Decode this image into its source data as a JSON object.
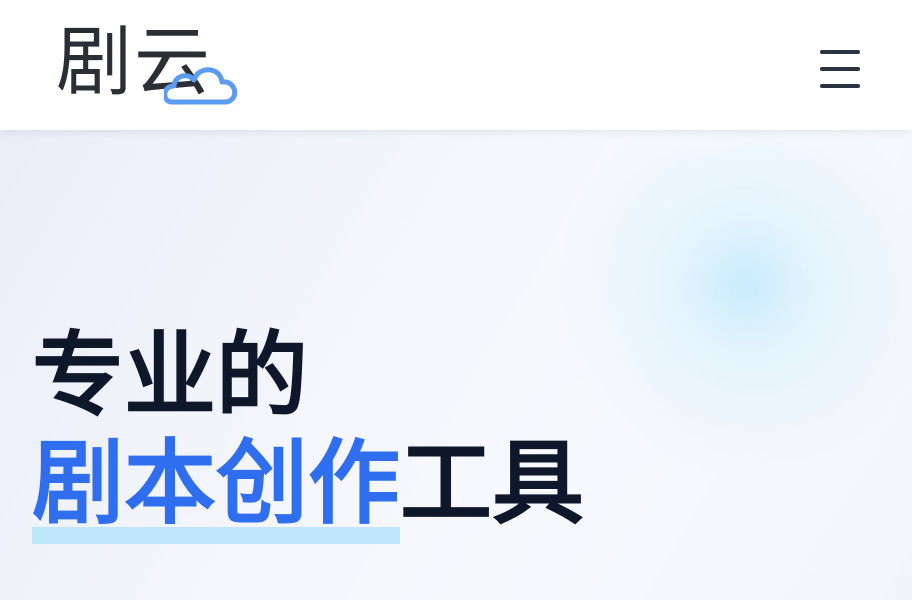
{
  "brand": {
    "logo_text": "剧云",
    "accent_color": "#2f6fef",
    "underline_color": "#bfe5fb",
    "cloud_color": "#5b9cf0"
  },
  "header": {
    "menu_icon": "hamburger-menu-icon"
  },
  "hero": {
    "line1": "专业的",
    "line2_accent": "剧本创作",
    "line2_rest": "工具"
  }
}
